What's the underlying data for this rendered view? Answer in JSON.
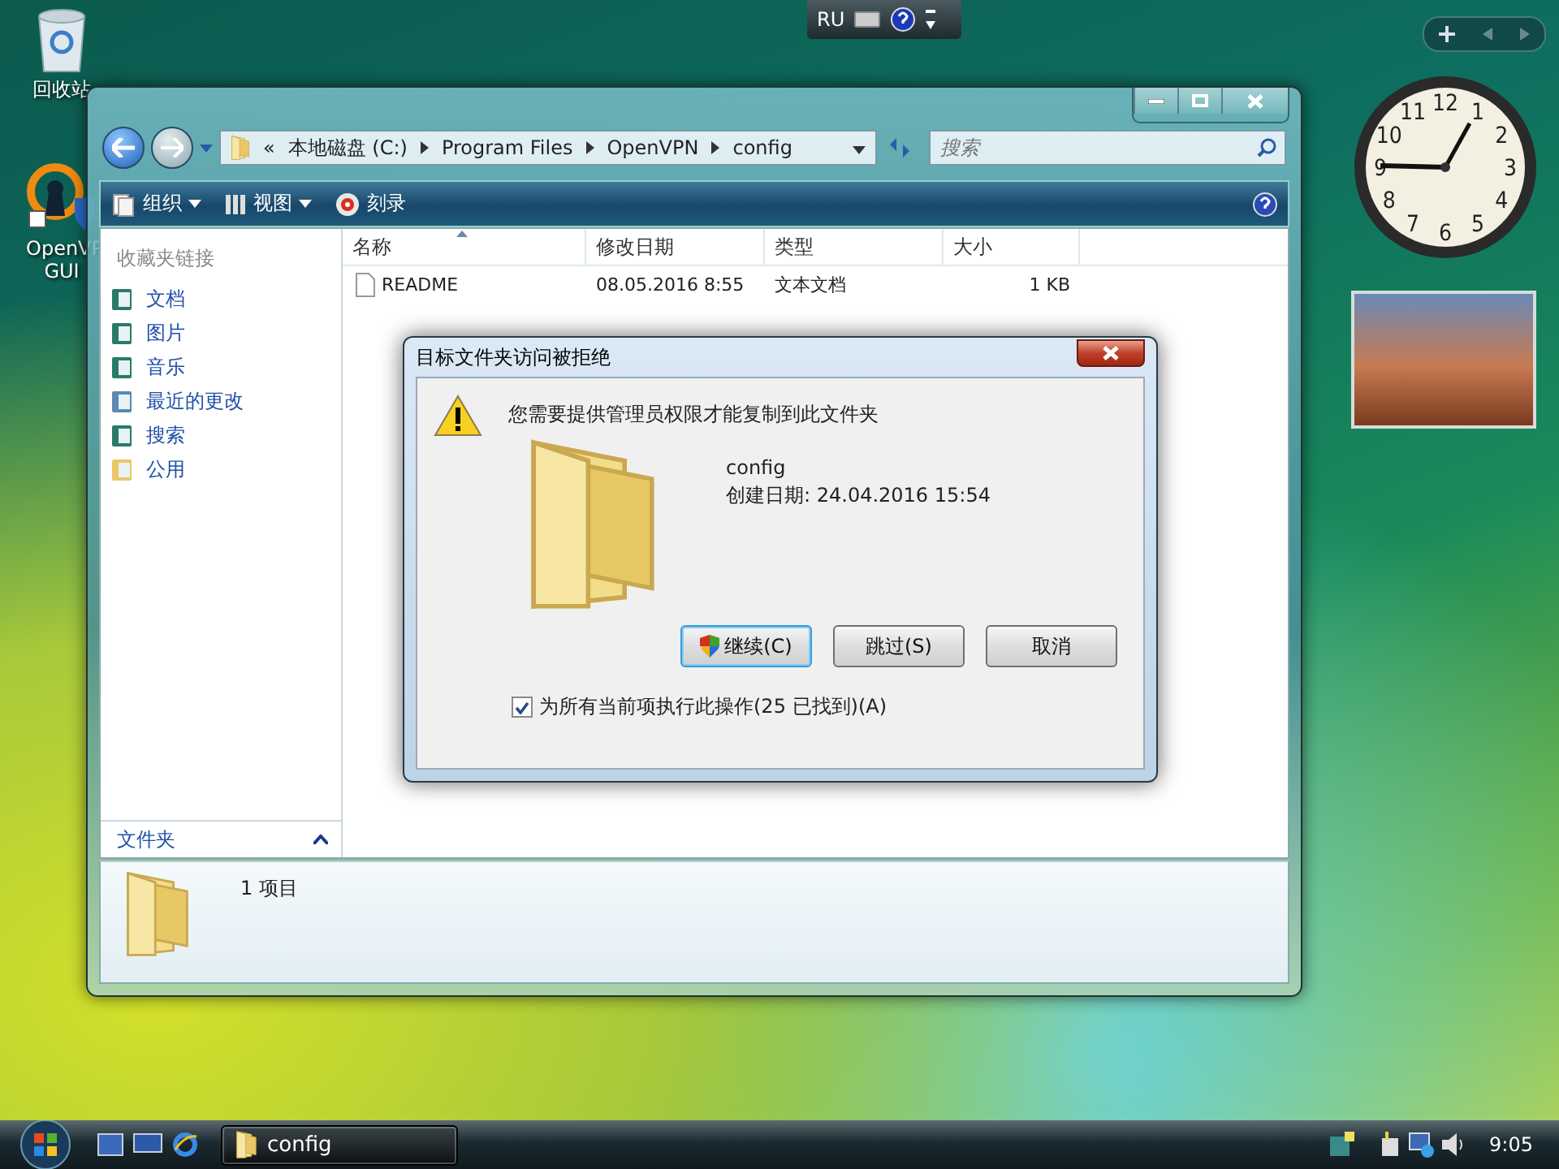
{
  "desktop_icons": [
    {
      "kind": "recycle-bin",
      "label": "回收站"
    },
    {
      "kind": "openvpn",
      "label": "OpenVP GUI"
    }
  ],
  "language_bar": {
    "language": "RU"
  },
  "clock_gadget": {
    "numerals": [
      "12",
      "11",
      "1",
      "10",
      "2",
      "9",
      "3",
      "8",
      "4",
      "7",
      "5",
      "6"
    ]
  },
  "explorer": {
    "address": {
      "overflow": "«",
      "crumbs": [
        "本地磁盘 (C:)",
        "Program Files",
        "OpenVPN",
        "config"
      ]
    },
    "search": {
      "placeholder": "搜索"
    },
    "toolbar": [
      {
        "kind": "organize",
        "label": "组织",
        "dropdown": true
      },
      {
        "kind": "views",
        "label": "视图",
        "dropdown": true
      },
      {
        "kind": "burn",
        "label": "刻录",
        "dropdown": false
      }
    ],
    "favorites": {
      "title": "收藏夹链接",
      "links": [
        {
          "kind": "documents",
          "label": "文档"
        },
        {
          "kind": "pictures",
          "label": "图片"
        },
        {
          "kind": "music",
          "label": "音乐"
        },
        {
          "kind": "recent",
          "label": "最近的更改"
        },
        {
          "kind": "searches",
          "label": "搜索"
        },
        {
          "kind": "public",
          "label": "公用"
        }
      ]
    },
    "folders_label": "文件夹",
    "columns": [
      {
        "label": "名称",
        "sorted": true
      },
      {
        "label": "修改日期",
        "sorted": false
      },
      {
        "label": "类型",
        "sorted": false
      },
      {
        "label": "大小",
        "sorted": false
      }
    ],
    "rows": [
      {
        "name": "README",
        "modified": "08.05.2016 8:55",
        "type": "文本文档",
        "size": "1 KB"
      }
    ],
    "details": "1 项目"
  },
  "dialog": {
    "title": "目标文件夹访问被拒绝",
    "message": "您需要提供管理员权限才能复制到此文件夹",
    "item_name": "config",
    "item_created": "创建日期: 24.04.2016 15:54",
    "buttons": [
      {
        "label": "继续(C)",
        "shield": true,
        "default": true
      },
      {
        "label": "跳过(S)",
        "shield": false,
        "default": false
      },
      {
        "label": "取消",
        "shield": false,
        "default": false
      }
    ],
    "apply_all": {
      "label": "为所有当前项执行此操作(25 已找到)(A)",
      "checked": true
    }
  },
  "taskbar": {
    "tasks": [
      {
        "label": "config"
      }
    ],
    "time": "9:05"
  }
}
